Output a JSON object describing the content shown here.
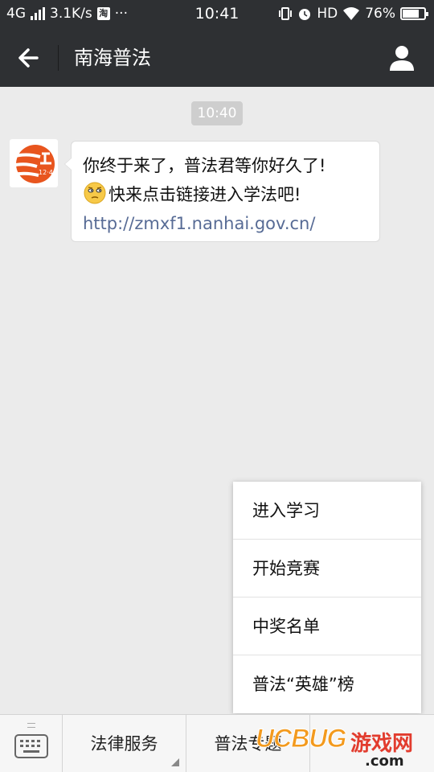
{
  "status_bar": {
    "network": "4G",
    "speed": "3.1K/s",
    "taobao_icon": "淘",
    "more": "···",
    "time": "10:41",
    "hd": "HD",
    "battery": "76%",
    "battery_level": 0.76
  },
  "nav": {
    "title": "南海普法",
    "back_icon": "arrow-left-icon",
    "profile_icon": "person-icon"
  },
  "chat": {
    "timestamp": "10:40",
    "message": {
      "line1": "你终于来了，普法君等你好久了!",
      "line2": "快来点击链接进入学法吧!",
      "link": "http://zmxf1.nanhai.gov.cn/",
      "emoji": "thinking-face-icon",
      "avatar_logo_text": "12·4"
    }
  },
  "popup_menu": {
    "items": [
      {
        "label": "进入学习"
      },
      {
        "label": "开始竞赛"
      },
      {
        "label": "中奖名单"
      },
      {
        "label": "普法“英雄”榜"
      }
    ]
  },
  "bottom_bar": {
    "keyboard_icon": "keyboard-icon",
    "tabs": [
      {
        "label": "法律服务"
      },
      {
        "label": "普法专题"
      },
      {
        "label": ""
      }
    ]
  },
  "watermark": {
    "brand": "UCBUG",
    "sub": "游戏网",
    "domain": ".com"
  },
  "colors": {
    "nav_bg": "#2e3033",
    "chat_bg": "#ebebeb",
    "link": "#576b95"
  }
}
